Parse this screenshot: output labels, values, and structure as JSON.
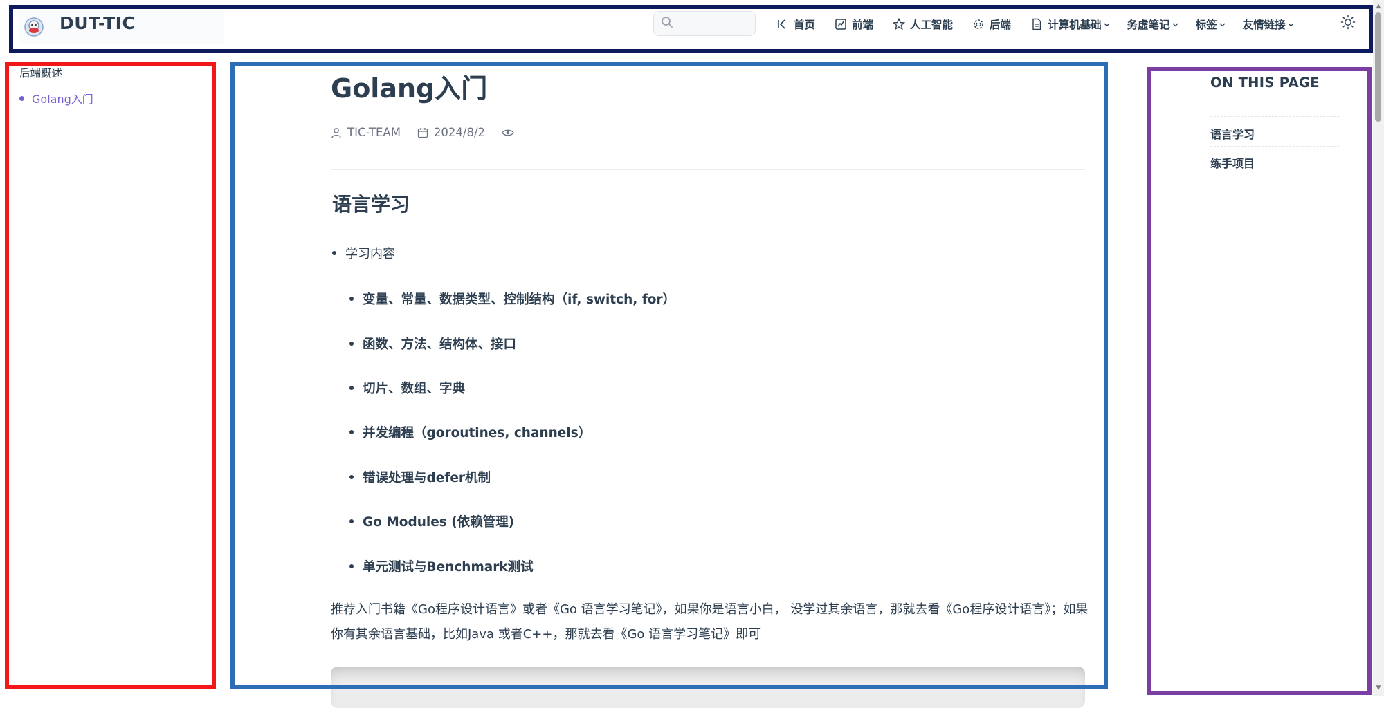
{
  "navbar": {
    "brand_title": "DUT-TIC",
    "search_placeholder": "",
    "items": [
      {
        "label": "首页",
        "icon": "back-to-start-icon"
      },
      {
        "label": "前端",
        "icon": "chart-icon"
      },
      {
        "label": "人工智能",
        "icon": "star-icon"
      },
      {
        "label": "后端",
        "icon": "gear-code-icon"
      },
      {
        "label": "计算机基础",
        "icon": "document-icon",
        "dropdown": true
      },
      {
        "label": "务虚笔记",
        "dropdown": true
      },
      {
        "label": "标签",
        "dropdown": true
      },
      {
        "label": "友情链接",
        "dropdown": true
      }
    ]
  },
  "sidebar": {
    "heading": "后端概述",
    "items": [
      {
        "label": "Golang入门",
        "active": true
      }
    ]
  },
  "article": {
    "title": "Golang入门",
    "author": "TIC-TEAM",
    "date": "2024/8/2",
    "section1_title": "语言学习",
    "bullet": "学习内容",
    "sub_items": [
      "变量、常量、数据类型、控制结构（if, switch, for）",
      "函数、方法、结构体、接口",
      "切片、数组、字典",
      "并发编程（goroutines, channels）",
      "错误处理与defer机制",
      "Go Modules (依赖管理)",
      "单元测试与Benchmark测试"
    ],
    "paragraph": "推荐入门书籍《Go程序设计语言》或者《Go 语言学习笔记》，如果你是语言小白， 没学过其余语言，那就去看《Go程序设计语言》；如果你有其余语言基础，比如Java 或者C++，那就去看《Go 语言学习笔记》即可"
  },
  "toc": {
    "title": "ON THIS PAGE",
    "items": [
      "语言学习",
      "练手项目"
    ]
  },
  "colors": {
    "nav_frame": "#0d1b5e",
    "sidebar_frame": "#f21818",
    "content_frame": "#2d6db5",
    "toc_frame": "#7b3fa3",
    "accent": "#7a5fd1",
    "text": "#2c3e50"
  }
}
